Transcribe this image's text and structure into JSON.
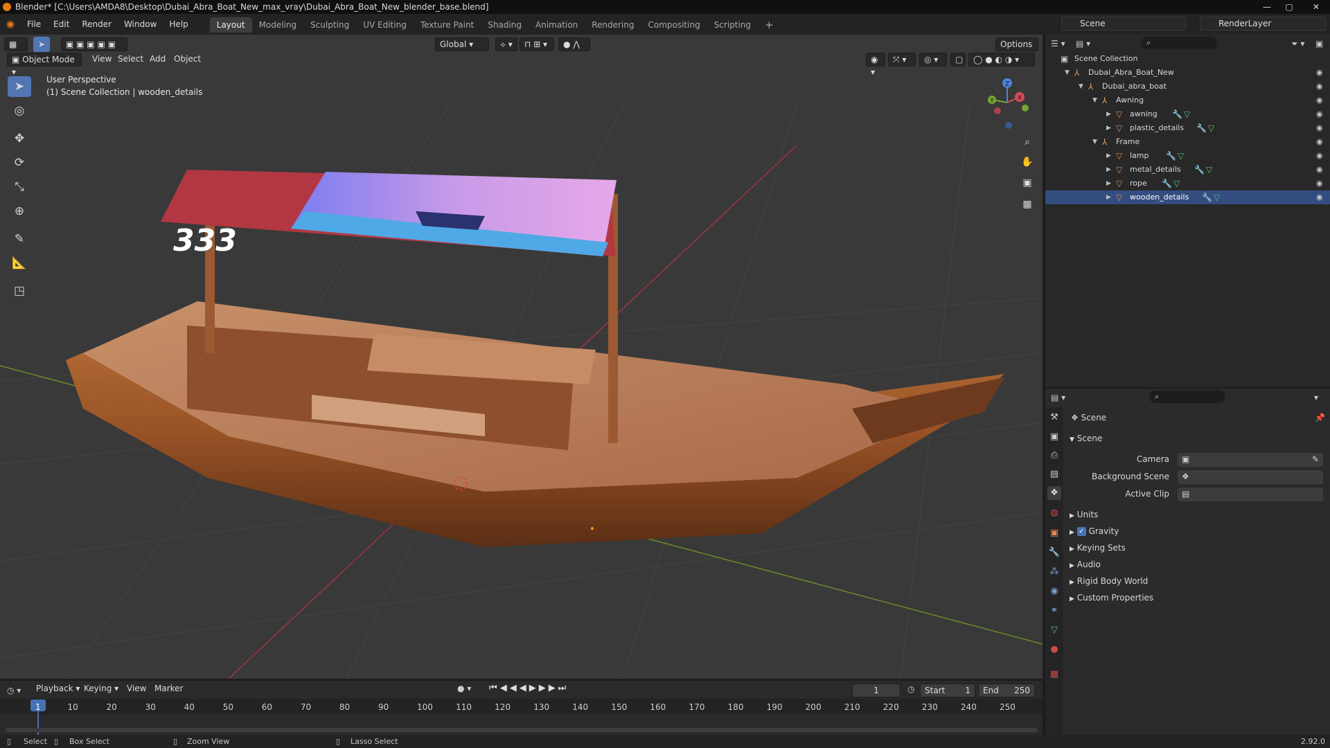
{
  "title": "Blender* [C:\\Users\\AMDA8\\Desktop\\Dubai_Abra_Boat_New_max_vray\\Dubai_Abra_Boat_New_blender_base.blend]",
  "menus": [
    "File",
    "Edit",
    "Render",
    "Window",
    "Help"
  ],
  "workspaces": [
    "Layout",
    "Modeling",
    "Sculpting",
    "UV Editing",
    "Texture Paint",
    "Shading",
    "Animation",
    "Rendering",
    "Compositing",
    "Scripting"
  ],
  "add_workspace": "+",
  "scene_name": "Scene",
  "render_layer": "RenderLayer",
  "viewport": {
    "transform": "Global",
    "options": "Options",
    "mode": "Object Mode",
    "menu": [
      "View",
      "Select",
      "Add",
      "Object"
    ],
    "perspective": "User Perspective",
    "collection_info": "(1) Scene Collection | wooden_details"
  },
  "gizmo": {
    "x": "X",
    "y": "Y",
    "z": "Z"
  },
  "boat_number": "333",
  "outliner": {
    "root": "Scene Collection",
    "items": [
      {
        "label": "Dubai_Abra_Boat_New"
      },
      {
        "label": "Dubai_abra_boat"
      },
      {
        "label": "Awning"
      },
      {
        "label": "awning"
      },
      {
        "label": "plastic_details"
      },
      {
        "label": "Frame"
      },
      {
        "label": "lamp"
      },
      {
        "label": "metal_details"
      },
      {
        "label": "rope"
      },
      {
        "label": "wooden_details"
      }
    ]
  },
  "properties": {
    "header": "Scene",
    "panel": "Scene",
    "fields": [
      {
        "label": "Camera"
      },
      {
        "label": "Background Scene"
      },
      {
        "label": "Active Clip"
      }
    ],
    "sections": [
      "Units",
      "Gravity",
      "Keying Sets",
      "Audio",
      "Rigid Body World",
      "Custom Properties"
    ],
    "gravity_enabled": true
  },
  "timeline": {
    "menus": [
      "Playback",
      "Keying",
      "View",
      "Marker"
    ],
    "current_frame": "1",
    "start_label": "Start",
    "start": "1",
    "end_label": "End",
    "end": "250",
    "ruler": [
      "1",
      "10",
      "20",
      "30",
      "40",
      "50",
      "60",
      "70",
      "80",
      "90",
      "100",
      "110",
      "120",
      "130",
      "140",
      "150",
      "160",
      "170",
      "180",
      "190",
      "200",
      "210",
      "220",
      "230",
      "240",
      "250"
    ]
  },
  "status": {
    "select": "Select",
    "box_select": "Box Select",
    "zoom_view": "Zoom View",
    "lasso_select": "Lasso Select",
    "version": "2.92.0"
  },
  "colors": {
    "accent": "#4772b3",
    "selected_tool": "#5276b4",
    "orange": "#e87d0d"
  }
}
